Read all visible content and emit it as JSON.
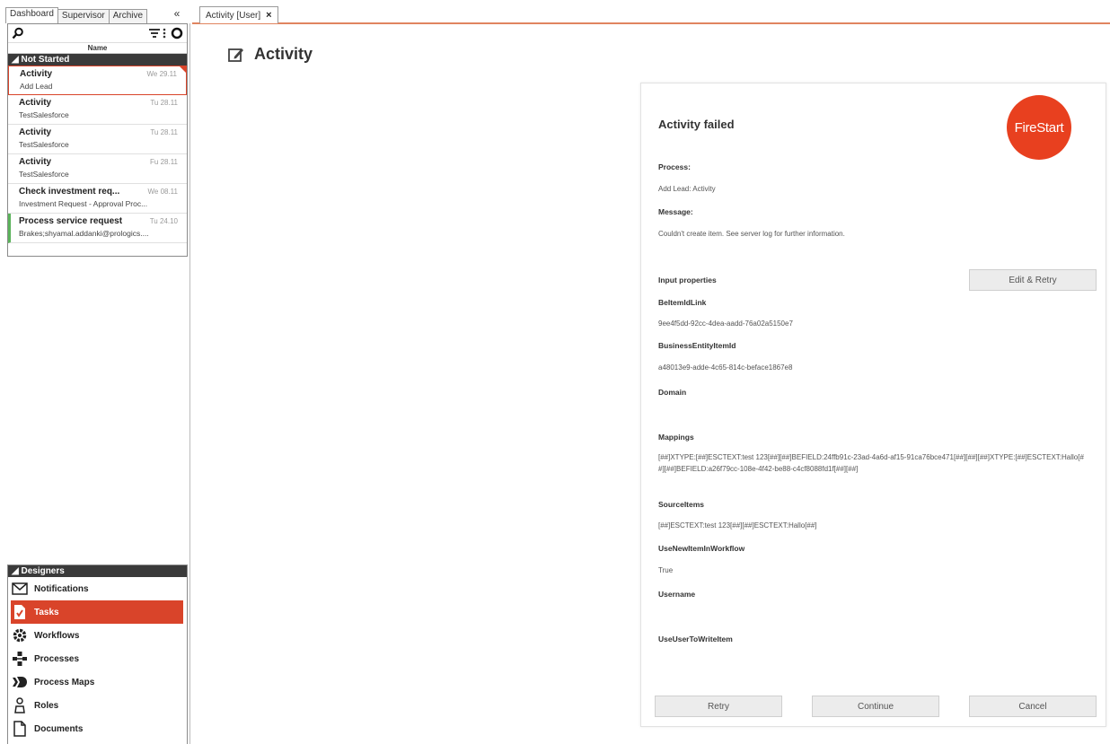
{
  "left_tabs": [
    "Dashboard",
    "Supervisor",
    "Archive"
  ],
  "collapse_glyph": "«",
  "tasklist": {
    "column_header": "Name",
    "group": "◢ Not Started",
    "items": [
      {
        "title": "Activity",
        "date": "We 29.11",
        "subtitle": "Add Lead",
        "selected": true
      },
      {
        "title": "Activity",
        "date": "Tu 28.11",
        "subtitle": "TestSalesforce"
      },
      {
        "title": "Activity",
        "date": "Tu 28.11",
        "subtitle": "TestSalesforce"
      },
      {
        "title": "Activity",
        "date": "Fu 28.11",
        "subtitle": "TestSalesforce"
      },
      {
        "title": "Check investment req...",
        "date": "We 08.11",
        "subtitle": "Investment Request - Approval Proc..."
      },
      {
        "title": "Process service request",
        "date": "Tu 24.10",
        "subtitle": "Brakes;shyamal.addanki@prologics....",
        "status_color": "#5bb35b"
      }
    ]
  },
  "designers": {
    "header": "◢ Designers",
    "items": [
      {
        "label": "Notifications",
        "icon": "envelope-icon"
      },
      {
        "label": "Tasks",
        "icon": "task-icon",
        "active": true
      },
      {
        "label": "Workflows",
        "icon": "gear-icon"
      },
      {
        "label": "Processes",
        "icon": "process-icon"
      },
      {
        "label": "Process Maps",
        "icon": "process-map-icon"
      },
      {
        "label": "Roles",
        "icon": "role-icon"
      },
      {
        "label": "Documents",
        "icon": "document-icon"
      }
    ]
  },
  "main_tab": {
    "label": "Activity [User]",
    "close": "×"
  },
  "page": {
    "title": "Activity"
  },
  "card": {
    "title": "Activity failed",
    "logo_text": "FireStart",
    "process_label": "Process:",
    "process_value": "Add Lead: Activity",
    "message_label": "Message:",
    "message_value": "Couldn't create item. See server log for further information.",
    "input_properties_label": "Input properties",
    "edit_retry": "Edit & Retry",
    "props": [
      {
        "name": "BeItemIdLink",
        "value": "9ee4f5dd-92cc-4dea-aadd-76a02a5150e7"
      },
      {
        "name": "BusinessEntityItemId",
        "value": "a48013e9-adde-4c65-814c-beface1867e8"
      },
      {
        "name": "Domain",
        "value": ""
      },
      {
        "name": "Mappings",
        "value": "[##]XTYPE:[##]ESCTEXT:test 123[##][##]BEFIELD:24ffb91c-23ad-4a6d-af15-91ca76bce471[##][##][##]XTYPE:[##]ESCTEXT:Hallo[##][##]BEFIELD:a26f79cc-108e-4f42-be88-c4cf8088fd1f[##][##]"
      },
      {
        "name": "SourceItems",
        "value": "[##]ESCTEXT:test 123[##][##]ESCTEXT:Hallo[##]"
      },
      {
        "name": "UseNewItemInWorkflow",
        "value": "True"
      },
      {
        "name": "Username",
        "value": ""
      },
      {
        "name": "UseUserToWriteItem",
        "value": ""
      }
    ],
    "buttons": {
      "retry": "Retry",
      "continue": "Continue",
      "cancel": "Cancel"
    }
  },
  "colors": {
    "accent": "#d9442a",
    "logo": "#e8401f",
    "status_green": "#5bb35b"
  }
}
